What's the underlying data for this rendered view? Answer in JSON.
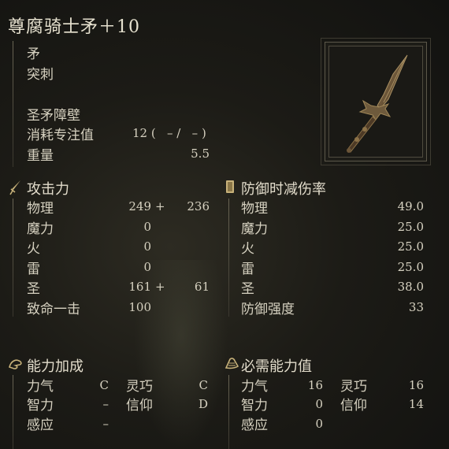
{
  "weapon": {
    "name": "尊腐骑士矛＋10",
    "type": "矛",
    "attack_type": "突刺"
  },
  "skill": {
    "name": "圣矛障壁",
    "fp_label": "消耗专注值",
    "fp_a": "12",
    "fp_b": "–",
    "fp_c": "–"
  },
  "weight": {
    "label": "重量",
    "value": "5.5"
  },
  "attack": {
    "title": "攻击力",
    "rows": [
      {
        "label": "物理",
        "base": "249",
        "plus": "+",
        "bonus": "236"
      },
      {
        "label": "魔力",
        "base": "0",
        "plus": "",
        "bonus": ""
      },
      {
        "label": "火",
        "base": "0",
        "plus": "",
        "bonus": ""
      },
      {
        "label": "雷",
        "base": "0",
        "plus": "",
        "bonus": ""
      },
      {
        "label": "圣",
        "base": "161",
        "plus": "+",
        "bonus": "61"
      },
      {
        "label": "致命一击",
        "base": "100",
        "plus": "",
        "bonus": ""
      }
    ]
  },
  "guard": {
    "title": "防御时减伤率",
    "rows": [
      {
        "label": "物理",
        "value": "49.0"
      },
      {
        "label": "魔力",
        "value": "25.0"
      },
      {
        "label": "火",
        "value": "25.0"
      },
      {
        "label": "雷",
        "value": "25.0"
      },
      {
        "label": "圣",
        "value": "38.0"
      },
      {
        "label": "防御强度",
        "value": "33"
      }
    ]
  },
  "scaling": {
    "title": "能力加成",
    "str": {
      "label": "力气",
      "value": "C"
    },
    "dex": {
      "label": "灵巧",
      "value": "C"
    },
    "int": {
      "label": "智力",
      "value": "–"
    },
    "fai": {
      "label": "信仰",
      "value": "D"
    },
    "arc": {
      "label": "感应",
      "value": "–"
    }
  },
  "requirements": {
    "title": "必需能力值",
    "str": {
      "label": "力气",
      "value": "16"
    },
    "dex": {
      "label": "灵巧",
      "value": "16"
    },
    "int": {
      "label": "智力",
      "value": "0"
    },
    "fai": {
      "label": "信仰",
      "value": "14"
    },
    "arc": {
      "label": "感应",
      "value": "0"
    }
  },
  "icons": [
    "sword-icon",
    "shield-icon",
    "hand-icon",
    "scroll-hand-icon",
    "spear-icon"
  ]
}
